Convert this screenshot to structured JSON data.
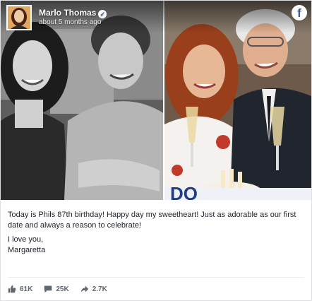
{
  "post": {
    "author": "Marlo Thomas",
    "timestamp": "about 5 months ago",
    "text_line1": "Today is Phils 87th birthday! Happy day my sweetheart! Just as adorable as our first date and always a reason to celebrate!",
    "text_line2": "I love you,",
    "text_line3": "Margaretta"
  },
  "stats": {
    "likes": "61K",
    "comments": "25K",
    "shares": "2.7K"
  },
  "icons": {
    "verified": "verified-check-icon",
    "facebook": "facebook-logo-icon",
    "like": "thumbs-up-icon",
    "comment": "comment-bubble-icon",
    "share": "share-arrow-icon"
  },
  "colors": {
    "brand": "#3b5998",
    "text": "#1d2129",
    "muted": "#606770"
  }
}
